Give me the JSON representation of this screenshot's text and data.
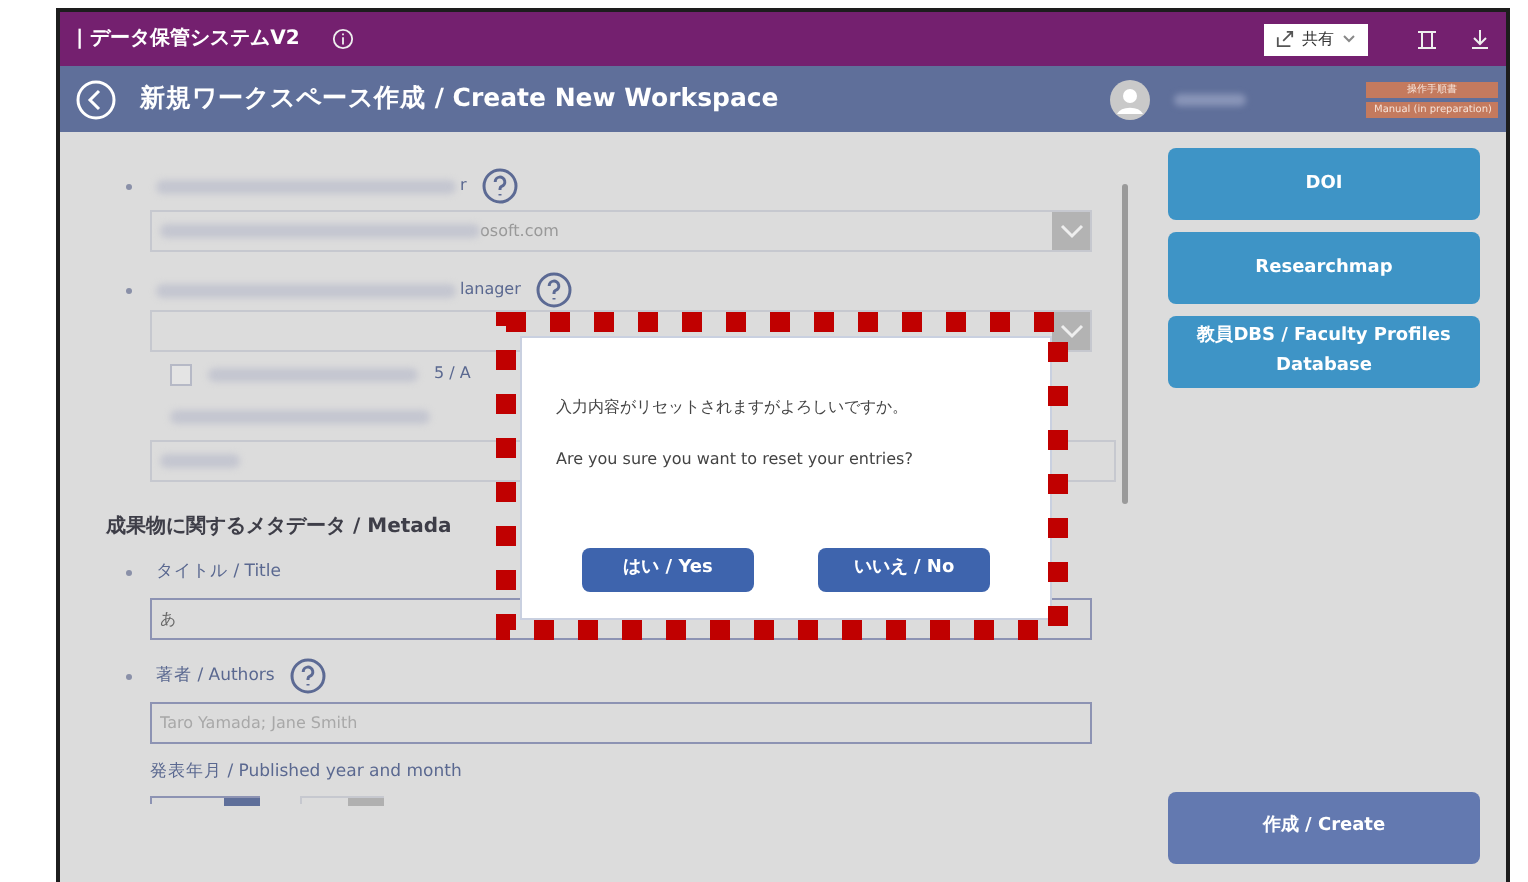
{
  "app_bar": {
    "title": "| データ保管システムV2",
    "share_label": "共有"
  },
  "header": {
    "title": "新規ワークスペース作成 / Create New Workspace",
    "tags": [
      "操作手順書",
      "Manual (in preparation)"
    ]
  },
  "form": {
    "operator": {
      "label_tail": "r",
      "value_tail": "osoft.com"
    },
    "manager": {
      "label_tail": "lanager",
      "checkbox_tail": "5 / A",
      "checked": false
    },
    "section_title": "成果物に関するメタデータ / Metada",
    "fields": [
      {
        "kind": "plain",
        "label": "タイトル / Title",
        "value": "あ"
      },
      {
        "kind": "help",
        "label": "著者 / Authors",
        "placeholder": "Taro Yamada; Jane Smith"
      }
    ],
    "published_label": "発表年月 / Published year and month"
  },
  "side_buttons": [
    "DOI",
    "Researchmap",
    "教員DBS / Faculty Profiles Database"
  ],
  "create_button": "作成 / Create",
  "dialog": {
    "message_ja": "入力内容がリセットされますがよろしいですか。",
    "message_en": "Are you sure you want to reset your entries?",
    "buttons": [
      "はい / Yes",
      "いいえ / No"
    ]
  }
}
